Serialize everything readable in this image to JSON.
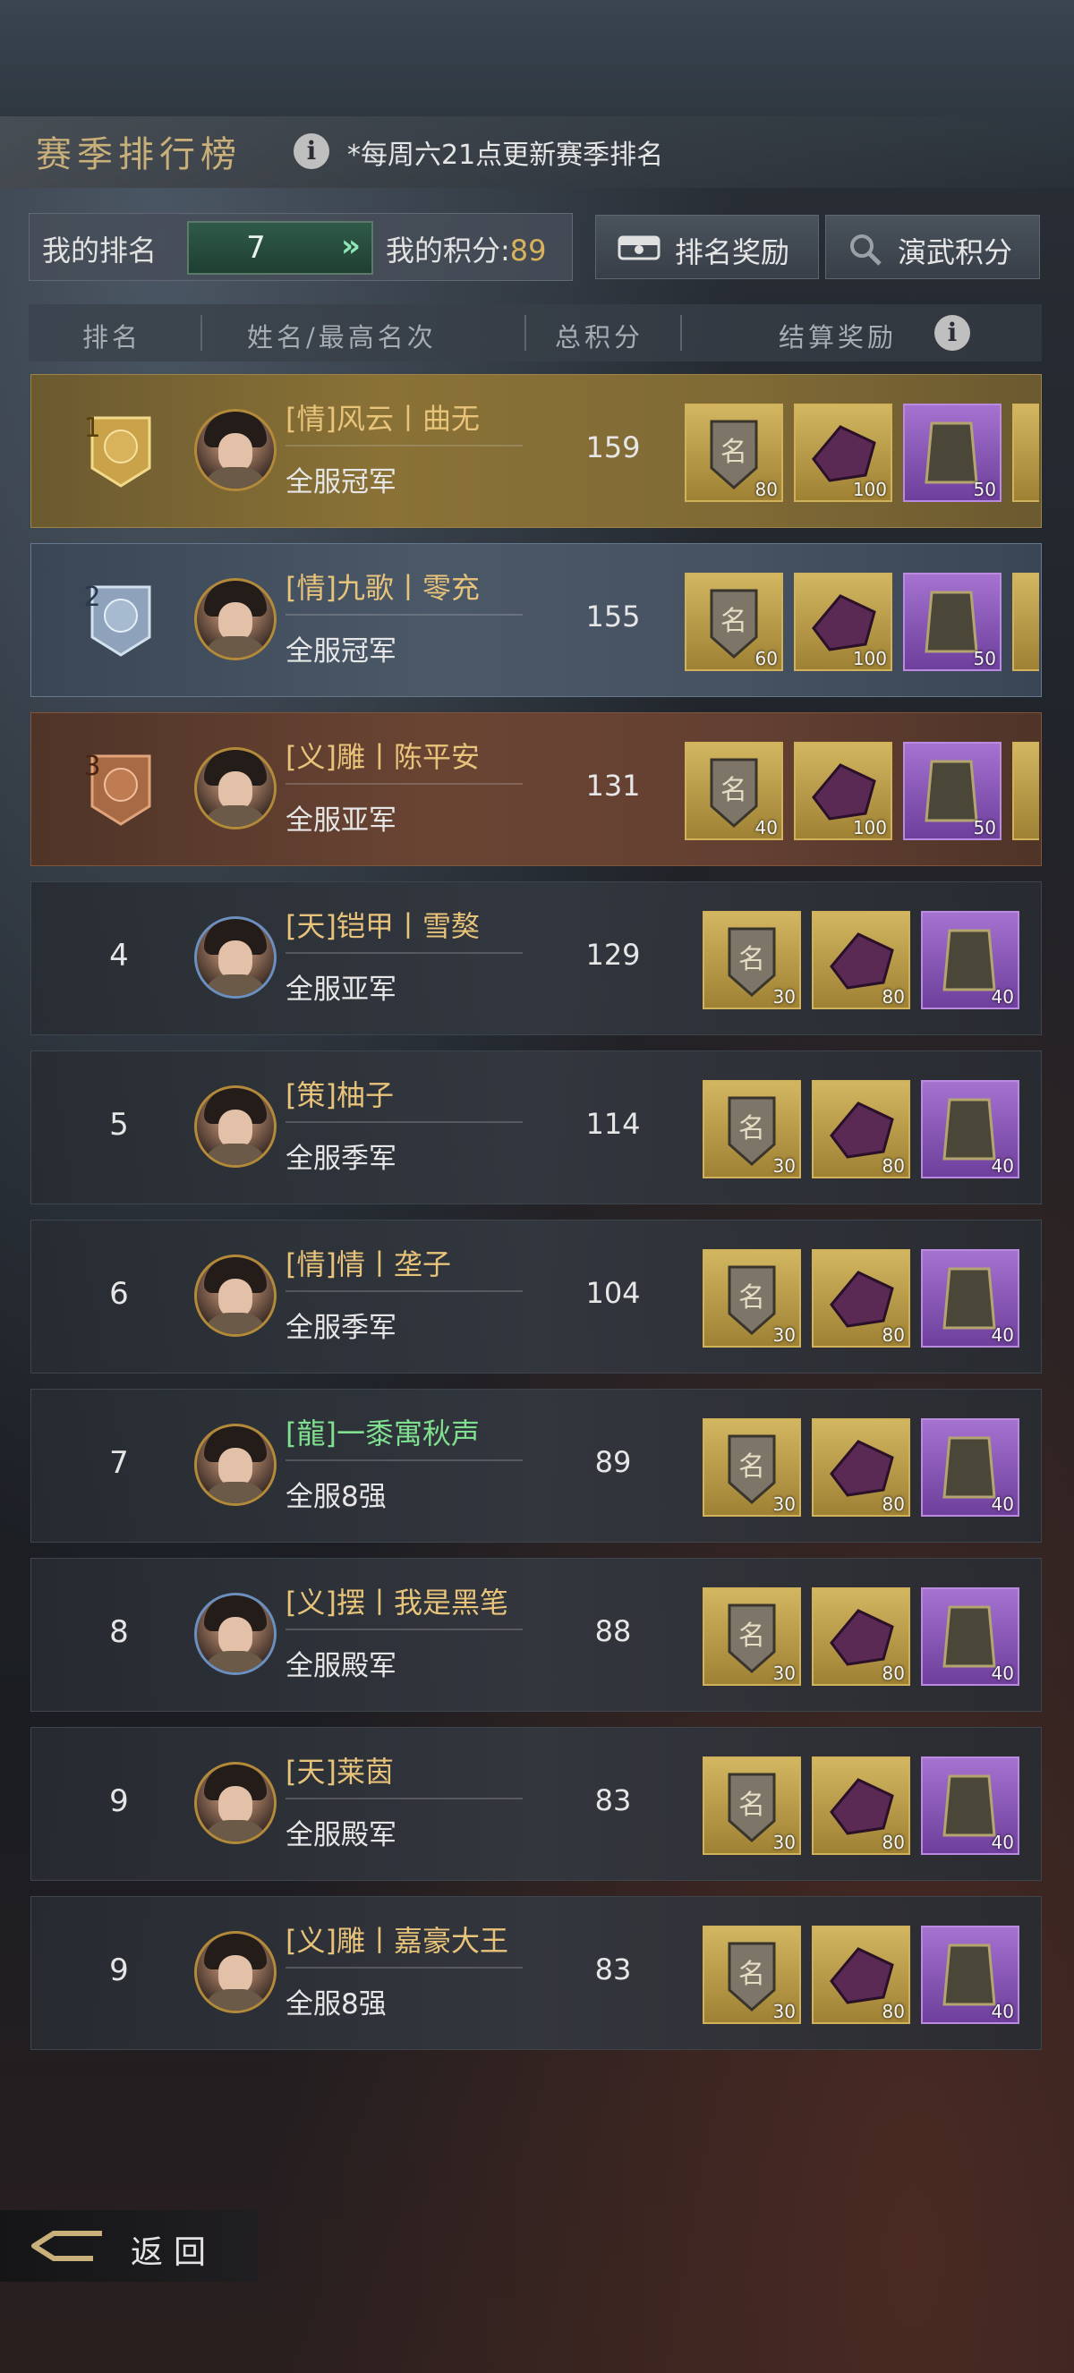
{
  "header": {
    "title": "赛季排行榜",
    "note": "*每周六21点更新赛季排名"
  },
  "my_stats": {
    "rank_label": "我的排名",
    "rank_value": "7",
    "score_label": "我的积分:",
    "score_value": "89"
  },
  "buttons": {
    "rank_reward": "排名奖励",
    "practice_score": "演武积分"
  },
  "columns": {
    "rank": "排名",
    "name": "姓名/最高名次",
    "score": "总积分",
    "reward": "结算奖励"
  },
  "rows": [
    {
      "rank": "1",
      "name": "[情]风云丨曲无",
      "title": "全服冠军",
      "score": "159",
      "rewards": [
        "80",
        "100",
        "50"
      ]
    },
    {
      "rank": "2",
      "name": "[情]九歌丨零充",
      "title": "全服冠军",
      "score": "155",
      "rewards": [
        "60",
        "100",
        "50"
      ]
    },
    {
      "rank": "3",
      "name": "[义]雕丨陈平安",
      "title": "全服亚军",
      "score": "131",
      "rewards": [
        "40",
        "100",
        "50"
      ]
    },
    {
      "rank": "4",
      "name": "[天]铠甲丨雪獒",
      "title": "全服亚军",
      "score": "129",
      "rewards": [
        "30",
        "80",
        "40"
      ]
    },
    {
      "rank": "5",
      "name": "[策]柚子",
      "title": "全服季军",
      "score": "114",
      "rewards": [
        "30",
        "80",
        "40"
      ]
    },
    {
      "rank": "6",
      "name": "[情]情丨垄子",
      "title": "全服季军",
      "score": "104",
      "rewards": [
        "30",
        "80",
        "40"
      ]
    },
    {
      "rank": "7",
      "name": "[龍]一黍寓秋声",
      "title": "全服8强",
      "score": "89",
      "rewards": [
        "30",
        "80",
        "40"
      ]
    },
    {
      "rank": "8",
      "name": "[义]摆丨我是黑笔",
      "title": "全服殿军",
      "score": "88",
      "rewards": [
        "30",
        "80",
        "40"
      ]
    },
    {
      "rank": "9",
      "name": "[天]莱茵",
      "title": "全服殿军",
      "score": "83",
      "rewards": [
        "30",
        "80",
        "40"
      ]
    },
    {
      "rank": "9",
      "name": "[义]雕丨嘉豪大王",
      "title": "全服8强",
      "score": "83",
      "rewards": [
        "30",
        "80",
        "40"
      ]
    }
  ],
  "footer": {
    "back": "返回"
  },
  "colors": {
    "gold_row": "#8a7236",
    "silver_row": "#4b5868",
    "bronze_row": "#6a4433",
    "highlight_name": "#7fe08f",
    "name": "#e8c37a"
  }
}
